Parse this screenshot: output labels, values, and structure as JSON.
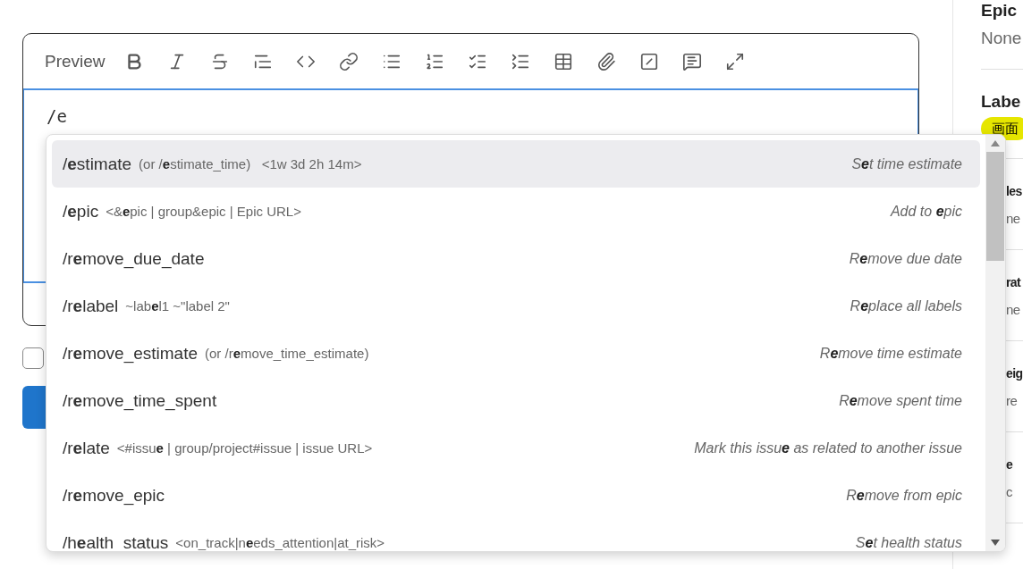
{
  "editor": {
    "tab": "Preview",
    "input_value": "/e"
  },
  "checkbox": {
    "checked": false
  },
  "autocomplete": [
    {
      "command": "/**e**stimate",
      "params": "(or /**e**stimate_time)   <1w 3d 2h 14m>",
      "description": "S**e**t time estimate",
      "selected": true
    },
    {
      "command": "/**e**pic",
      "params": "<&**e**pic | group&epic | Epic URL>",
      "description": "Add to **e**pic",
      "selected": false
    },
    {
      "command": "/r**e**move_due_date",
      "description": "R**e**move due date",
      "selected": false
    },
    {
      "command": "/r**e**label",
      "params": "~lab**e**l1 ~\"label 2\"",
      "description": "R**e**place all labels",
      "selected": false
    },
    {
      "command": "/r**e**move_estimate",
      "params": "(or /r**e**move_time_estimate)",
      "description": "R**e**move time estimate",
      "selected": false
    },
    {
      "command": "/r**e**move_time_spent",
      "description": "R**e**move spent time",
      "selected": false
    },
    {
      "command": "/r**e**late",
      "params": "<#issu**e** | group/project#issue | issue URL>",
      "description": "Mark this issu**e** as related to another issue",
      "selected": false
    },
    {
      "command": "/r**e**move_epic",
      "description": "R**e**move from epic",
      "selected": false
    },
    {
      "command": "/h**e**alth_status",
      "params": "<on_track|n**e**eds_attention|at_risk>",
      "description": "S**e**t health status",
      "selected": false
    }
  ],
  "sidebar": [
    {
      "title": "Epic",
      "value": "None",
      "covered": false
    },
    {
      "title": "Labe",
      "label": "画面",
      "covered": false
    },
    {
      "title": "les",
      "value": "ne",
      "covered": true
    },
    {
      "title": "rat",
      "value": "ne",
      "covered": true
    },
    {
      "title": "eig",
      "value": "re",
      "covered": true
    },
    {
      "title": "e",
      "value": "c",
      "covered": true
    }
  ]
}
